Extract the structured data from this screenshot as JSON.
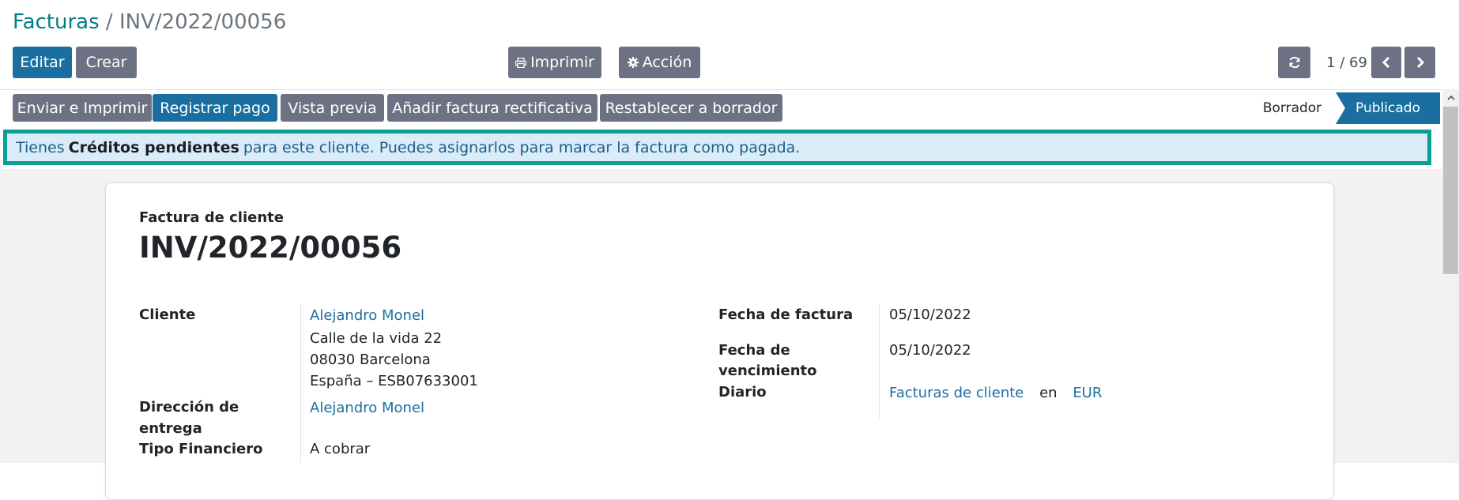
{
  "breadcrumb": {
    "root": "Facturas",
    "separator": "/",
    "current": "INV/2022/00056"
  },
  "toolbar": {
    "edit": "Editar",
    "create": "Crear",
    "print": "Imprimir",
    "action": "Acción"
  },
  "pager": {
    "value": "1 / 69"
  },
  "actions": [
    "Enviar e Imprimir",
    "Registrar pago",
    "Vista previa",
    "Añadir factura rectificativa",
    "Restablecer a borrador"
  ],
  "status": {
    "draft": "Borrador",
    "posted": "Publicado",
    "active": "Publicado"
  },
  "alert": {
    "prefix": "Tienes",
    "bold": "Créditos pendientes",
    "suffix": "para este cliente. Puedes asignarlos para marcar la factura como pagada."
  },
  "form": {
    "doc_type": "Factura de cliente",
    "doc_name": "INV/2022/00056",
    "customer_label": "Cliente",
    "customer_name": "Alejandro Monel",
    "customer_address": [
      "Calle de la vida 22",
      "08030 Barcelona",
      "España – ESB07633001"
    ],
    "delivery_label_1": "Dirección de",
    "delivery_label_2": "entrega",
    "delivery_value": "Alejandro Monel",
    "financial_label": "Tipo Financiero",
    "financial_value": "A cobrar",
    "invoice_date_label": "Fecha de factura",
    "invoice_date": "05/10/2022",
    "due_date_label_1": "Fecha de",
    "due_date_label_2": "vencimiento",
    "due_date": "05/10/2022",
    "journal_label": "Diario",
    "journal_value": "Facturas de cliente",
    "journal_in": "en",
    "journal_currency": "EUR"
  },
  "colors": {
    "primary": "#1a6fa0",
    "secondary": "#6c7283",
    "alert_border": "#0b9e94",
    "alert_bg": "#d9ecf8",
    "breadcrumb_link": "#017e84"
  }
}
